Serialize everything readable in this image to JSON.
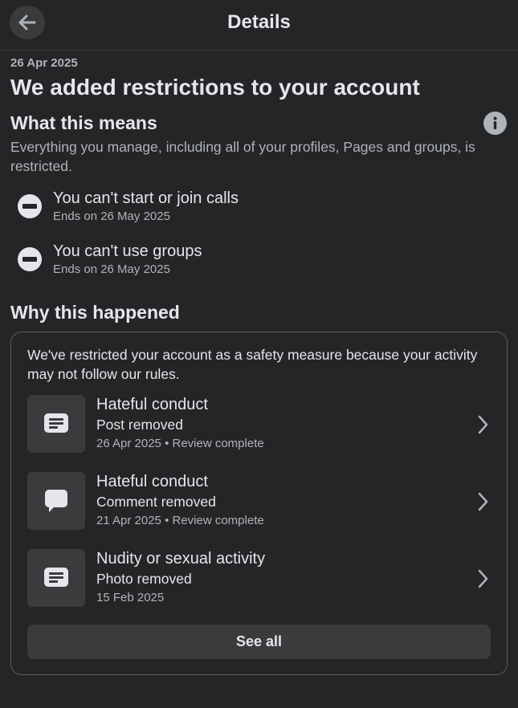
{
  "header": {
    "title": "Details",
    "back_icon": "arrow-left-icon"
  },
  "date": "26 Apr 2025",
  "headline": "We added restrictions to your account",
  "what_this_means": {
    "title": "What this means",
    "info_icon": "info-icon",
    "description": "Everything you manage, including all of your profiles, Pages and groups, is restricted.",
    "restrictions": [
      {
        "icon": "no-entry-icon",
        "title": "You can't start or join calls",
        "ends": "Ends on 26 May 2025"
      },
      {
        "icon": "no-entry-icon",
        "title": "You can't use groups",
        "ends": "Ends on 26 May 2025"
      }
    ]
  },
  "why": {
    "title": "Why this happened",
    "intro": "We've restricted your account as a safety measure because your activity may not follow our rules.",
    "violations": [
      {
        "icon": "post-icon",
        "title": "Hateful conduct",
        "action": "Post removed",
        "meta": "26 Apr 2025 • Review complete"
      },
      {
        "icon": "comment-icon",
        "title": "Hateful conduct",
        "action": "Comment removed",
        "meta": "21 Apr 2025 • Review complete"
      },
      {
        "icon": "post-icon",
        "title": "Nudity or sexual activity",
        "action": "Photo removed",
        "meta": "15 Feb 2025"
      }
    ],
    "see_all_label": "See all"
  },
  "colors": {
    "background": "#242526",
    "surface": "#3a3b3c",
    "text_primary": "#e4e6eb",
    "text_secondary": "#b0b3b8"
  }
}
